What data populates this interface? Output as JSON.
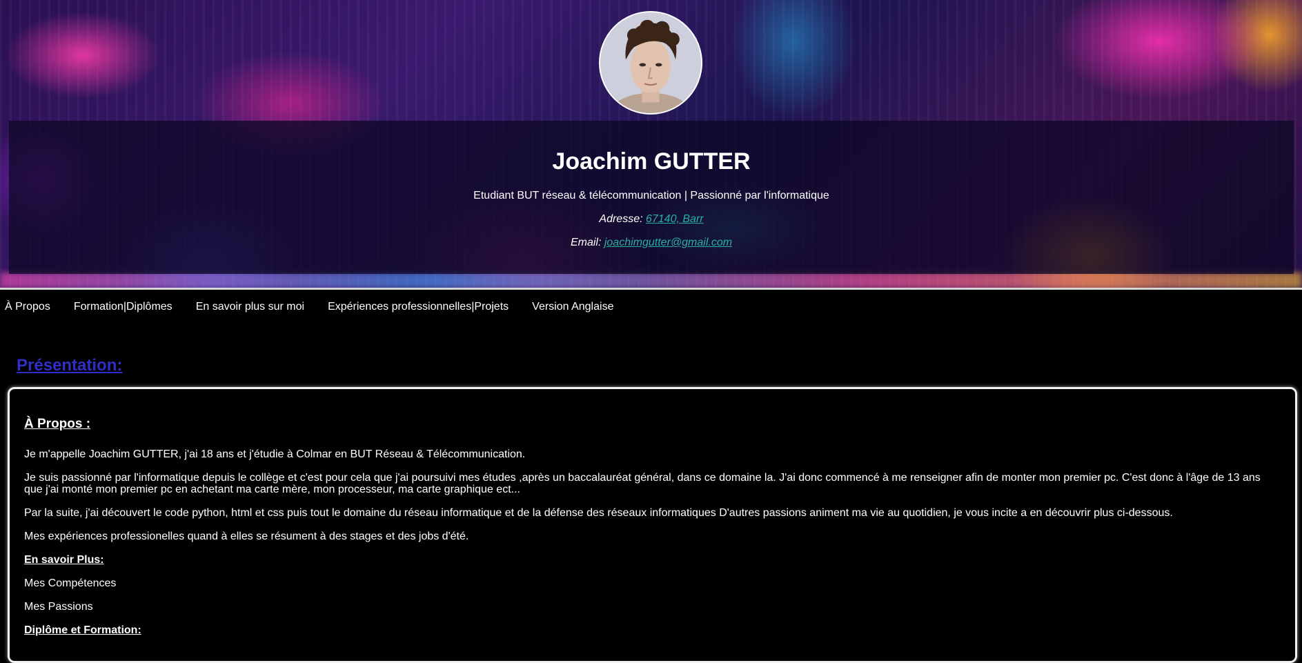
{
  "header": {
    "name": "Joachim GUTTER",
    "subtitle": "Etudiant BUT réseau & télécommunication | Passionné par l'informatique",
    "address_label": "Adresse: ",
    "address_value": "67140, Barr",
    "email_label": "Email: ",
    "email_value": "joachimgutter@gmail.com"
  },
  "nav": {
    "items": [
      "À Propos",
      "Formation|Diplômes",
      "En savoir plus sur moi",
      "Expériences professionnelles|Projets",
      "Version Anglaise"
    ]
  },
  "presentation": {
    "title": "Présentation:",
    "about_heading": "À Propos :",
    "paragraphs": [
      "Je m'appelle Joachim GUTTER, j'ai 18 ans et j'étudie à Colmar en BUT Réseau & Télécommunication.",
      "Je suis passionné par l'informatique depuis le collège et c'est pour cela que j'ai poursuivi mes études ,après un baccalauréat général, dans ce domaine la. J'ai donc commencé à me renseigner afin de monter mon premier pc. C'est donc à l'âge de 13 ans que j'ai monté mon premier pc en achetant ma carte mère, mon processeur, ma carte graphique ect...",
      "Par la suite, j'ai découvert le code python, html et css puis tout le domaine du réseau informatique et de la défense des réseaux informatiques D'autres passions animent ma vie au quotidien, je vous incite a en découvrir plus ci-dessous.",
      "Mes expériences professionelles quand à elles se résument à des stages et des jobs d'été."
    ],
    "more_heading": "En savoir Plus:",
    "more_items": [
      "Mes Compétences",
      "Mes Passions"
    ],
    "diploma_heading": "Diplôme et Formation:"
  },
  "colors": {
    "background": "#000000",
    "link_teal": "#2bb0a0",
    "section_title_blue": "#2f2fc8"
  }
}
